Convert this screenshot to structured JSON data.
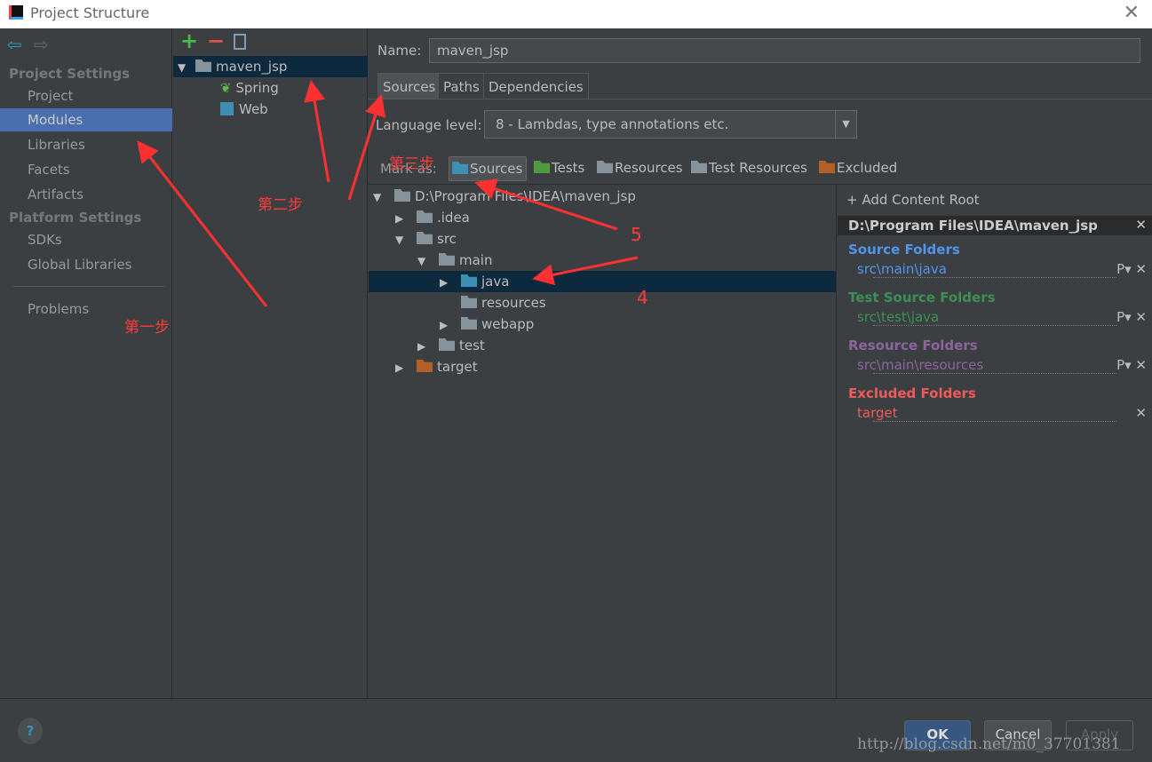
{
  "window": {
    "title": "Project Structure",
    "close": "✕"
  },
  "nav": {
    "sections": [
      "Project Settings",
      "Platform Settings"
    ],
    "project_items": [
      "Project",
      "Modules",
      "Libraries",
      "Facets",
      "Artifacts"
    ],
    "platform_items": [
      "SDKs",
      "Global Libraries"
    ],
    "problems": "Problems",
    "selected": "Modules"
  },
  "modules": {
    "toolbar": [
      "+",
      "−"
    ],
    "root": "maven_jsp",
    "children": [
      "Spring",
      "Web"
    ]
  },
  "name_field": {
    "label": "Name:",
    "value": "maven_jsp"
  },
  "tabs": [
    "Sources",
    "Paths",
    "Dependencies"
  ],
  "active_tab": "Sources",
  "language_level": {
    "label": "Language level:",
    "value": "8 - Lambdas, type annotations etc."
  },
  "mark_as": {
    "label": "Mark as:",
    "buttons": [
      "Sources",
      "Tests",
      "Resources",
      "Test Resources",
      "Excluded"
    ],
    "colors": {
      "Sources": "#3d8fb5",
      "Tests": "#4e9a3e",
      "Resources": "#87939a",
      "Excluded": "#b35f2a"
    }
  },
  "tree": [
    {
      "label": "D:\\Program Files\\IDEA\\maven_jsp",
      "depth": 0,
      "expanded": true,
      "kind": "plain"
    },
    {
      "label": ".idea",
      "depth": 1,
      "expanded": false,
      "kind": "plain"
    },
    {
      "label": "src",
      "depth": 1,
      "expanded": true,
      "kind": "plain"
    },
    {
      "label": "main",
      "depth": 2,
      "expanded": true,
      "kind": "plain"
    },
    {
      "label": "java",
      "depth": 3,
      "expanded": false,
      "kind": "source",
      "selected": true
    },
    {
      "label": "resources",
      "depth": 3,
      "kind": "resource"
    },
    {
      "label": "webapp",
      "depth": 3,
      "expanded": false,
      "kind": "plain"
    },
    {
      "label": "test",
      "depth": 2,
      "expanded": false,
      "kind": "plain"
    },
    {
      "label": "target",
      "depth": 1,
      "expanded": false,
      "kind": "excluded"
    }
  ],
  "content_root": {
    "add": "+ Add Content Root",
    "path": "D:\\Program Files\\IDEA\\maven_jsp",
    "groups": [
      {
        "title": "Source Folders",
        "value": "src\\main\\java",
        "color": "#5394ec"
      },
      {
        "title": "Test Source Folders",
        "value": "src\\test\\java",
        "color": "#3d8f58"
      },
      {
        "title": "Resource Folders",
        "value": "src\\main\\resources",
        "color": "#8d649e"
      },
      {
        "title": "Excluded Folders",
        "value": "target",
        "color": "#ef5a5a"
      }
    ]
  },
  "buttons": {
    "help": "?",
    "ok": "OK",
    "cancel": "Cancel",
    "apply": "Apply"
  },
  "annotations": {
    "step1": "第一步",
    "step2": "第二步",
    "step3": "第三步",
    "n5": "5",
    "n4": "4"
  },
  "watermark": "http://blog.csdn.net/m0_37701381"
}
